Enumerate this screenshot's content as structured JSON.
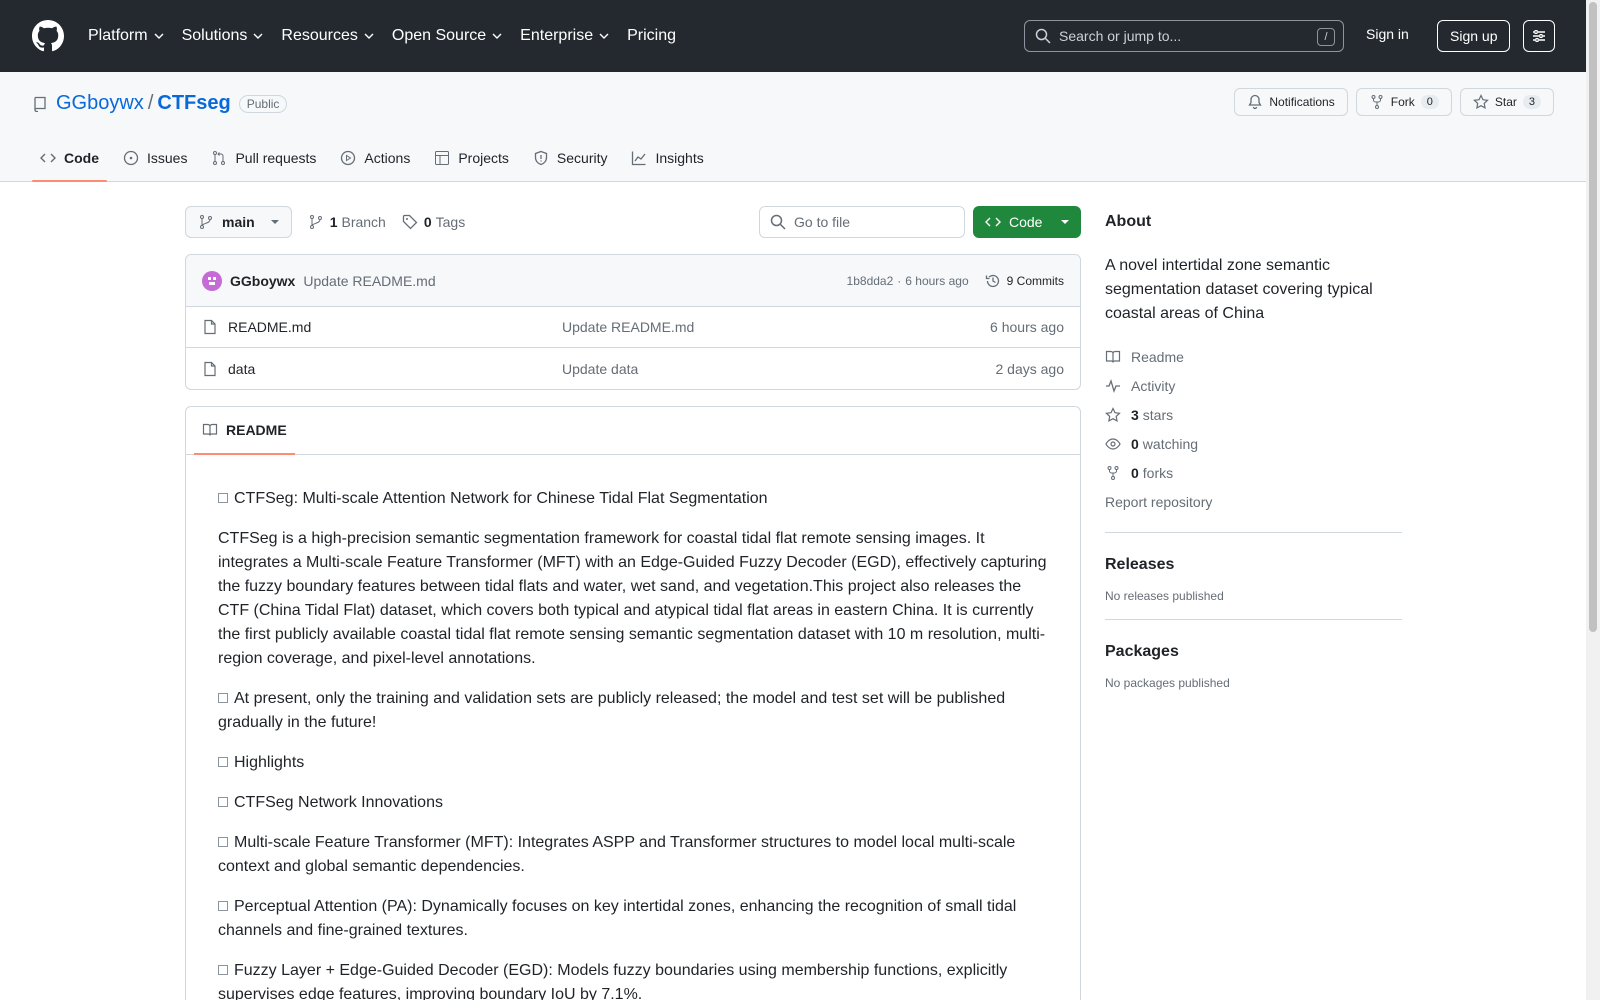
{
  "header": {
    "nav": [
      {
        "label": "Platform",
        "has_menu": true
      },
      {
        "label": "Solutions",
        "has_menu": true
      },
      {
        "label": "Resources",
        "has_menu": true
      },
      {
        "label": "Open Source",
        "has_menu": true
      },
      {
        "label": "Enterprise",
        "has_menu": true
      },
      {
        "label": "Pricing",
        "has_menu": false
      }
    ],
    "search_placeholder": "Search or jump to...",
    "search_shortcut": "/",
    "sign_in": "Sign in",
    "sign_up": "Sign up"
  },
  "repo": {
    "owner": "GGboywx",
    "separator": "/",
    "name": "CTFseg",
    "visibility": "Public",
    "notifications_label": "Notifications",
    "fork_label": "Fork",
    "fork_count": "0",
    "star_label": "Star",
    "star_count": "3",
    "tabs": [
      {
        "label": "Code",
        "icon": "code-icon",
        "active": true
      },
      {
        "label": "Issues",
        "icon": "issue-icon",
        "active": false
      },
      {
        "label": "Pull requests",
        "icon": "pull-request-icon",
        "active": false
      },
      {
        "label": "Actions",
        "icon": "play-icon",
        "active": false
      },
      {
        "label": "Projects",
        "icon": "table-icon",
        "active": false
      },
      {
        "label": "Security",
        "icon": "shield-icon",
        "active": false
      },
      {
        "label": "Insights",
        "icon": "graph-icon",
        "active": false
      }
    ]
  },
  "toolbar": {
    "branch": "main",
    "branch_count": "1",
    "branch_label": "Branch",
    "tag_count": "0",
    "tag_label": "Tags",
    "goto_placeholder": "Go to file",
    "code_button": "Code"
  },
  "latest_commit": {
    "author": "GGboywx",
    "message": "Update README.md",
    "hash": "1b8dda2",
    "separator": "·",
    "age": "6 hours ago",
    "commits_count": "9 Commits"
  },
  "files": [
    {
      "name": "README.md",
      "type": "file",
      "commit": "Update README.md",
      "age": "6 hours ago"
    },
    {
      "name": "data",
      "type": "file",
      "commit": "Update data",
      "age": "2 days ago"
    }
  ],
  "readme": {
    "tab_label": "README",
    "paragraphs": [
      {
        "box": true,
        "text": "CTFSeg: Multi-scale Attention Network for Chinese Tidal Flat Segmentation"
      },
      {
        "box": false,
        "text": "CTFSeg is a high-precision semantic segmentation framework for coastal tidal flat remote sensing images. It integrates a Multi-scale Feature Transformer (MFT) with an Edge-Guided Fuzzy Decoder (EGD), effectively capturing the fuzzy boundary features between tidal flats and water, wet sand, and vegetation.This project also releases the CTF (China Tidal Flat) dataset, which covers both typical and atypical tidal flat areas in eastern China. It is currently the first publicly available coastal tidal flat remote sensing semantic segmentation dataset with 10 m resolution, multi-region coverage, and pixel-level annotations."
      },
      {
        "box": true,
        "text": "At present, only the training and validation sets are publicly released; the model and test set will be published gradually in the future!"
      },
      {
        "box": true,
        "text": "Highlights"
      },
      {
        "box": true,
        "text": "CTFSeg Network Innovations"
      },
      {
        "box": true,
        "text": "Multi-scale Feature Transformer (MFT): Integrates ASPP and Transformer structures to model local multi-scale context and global semantic dependencies."
      },
      {
        "box": true,
        "text": "Perceptual Attention (PA): Dynamically focuses on key intertidal zones, enhancing the recognition of small tidal channels and fine-grained textures."
      },
      {
        "box": true,
        "text": "Fuzzy Layer + Edge-Guided Decoder (EGD): Models fuzzy boundaries using membership functions, explicitly supervises edge features, improving boundary IoU by 7.1%."
      }
    ]
  },
  "about": {
    "title": "About",
    "description": "A novel intertidal zone semantic segmentation dataset covering typical coastal areas of China",
    "links": [
      {
        "icon": "book-icon",
        "count": "",
        "label": "Readme"
      },
      {
        "icon": "pulse-icon",
        "count": "",
        "label": "Activity"
      },
      {
        "icon": "star-icon",
        "count": "3",
        "label": "stars"
      },
      {
        "icon": "eye-icon",
        "count": "0",
        "label": "watching"
      },
      {
        "icon": "fork-icon",
        "count": "0",
        "label": "forks"
      }
    ],
    "report": "Report repository"
  },
  "releases": {
    "title": "Releases",
    "empty": "No releases published"
  },
  "packages": {
    "title": "Packages",
    "empty": "No packages published"
  },
  "colors": {
    "header_bg": "#24292f",
    "accent": "#0969da",
    "primary_button": "#1f883d",
    "active_tab_underline": "#fd8c73"
  }
}
